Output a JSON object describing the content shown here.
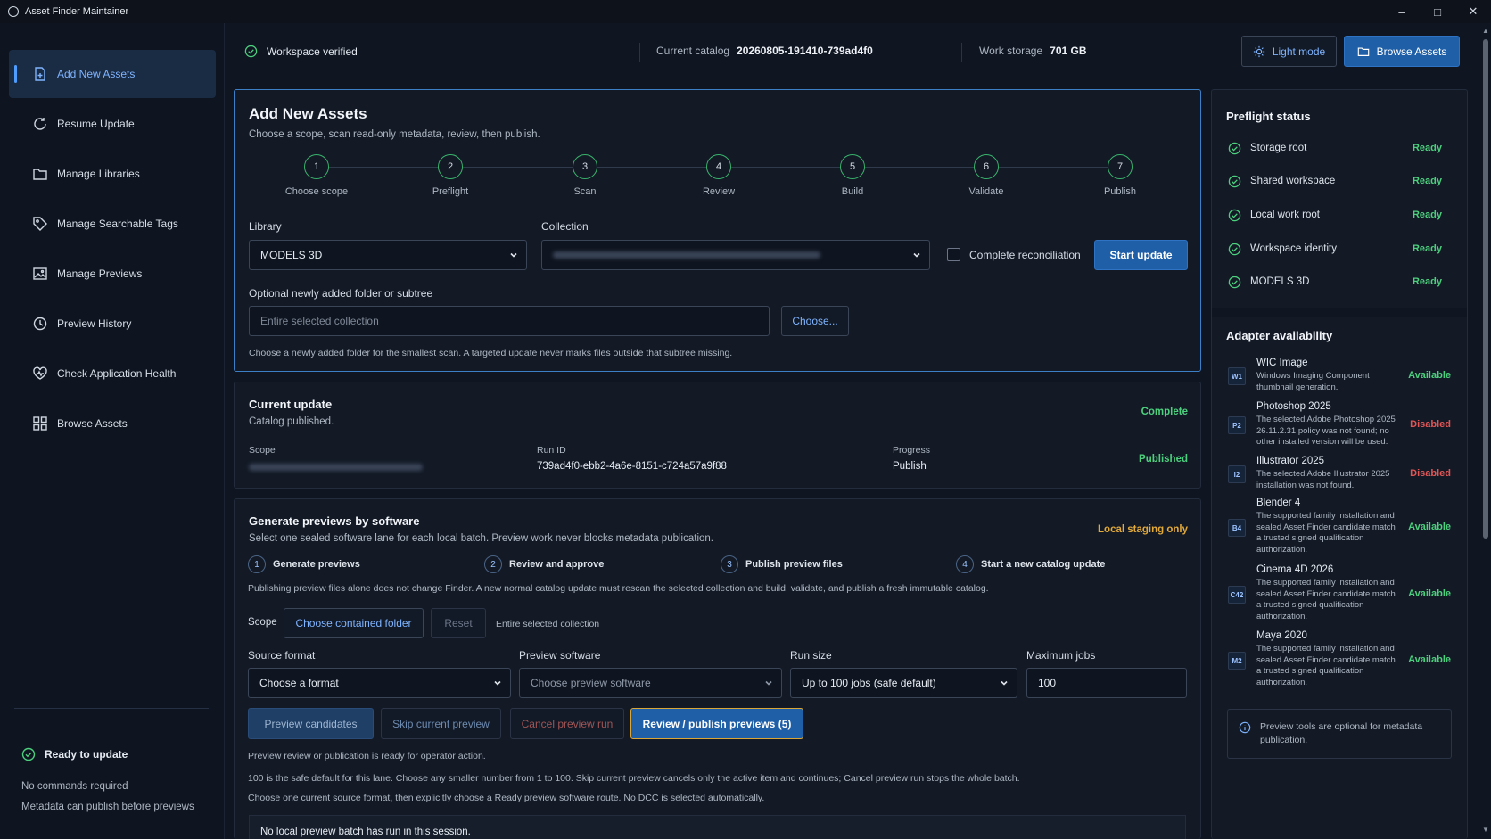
{
  "window": {
    "title": "Asset Finder Maintainer"
  },
  "sidebar": {
    "items": [
      {
        "label": "Add New Assets"
      },
      {
        "label": "Resume Update"
      },
      {
        "label": "Manage Libraries"
      },
      {
        "label": "Manage Searchable Tags"
      },
      {
        "label": "Manage Previews"
      },
      {
        "label": "Preview History"
      },
      {
        "label": "Check Application Health"
      },
      {
        "label": "Browse Assets"
      }
    ],
    "ready_label": "Ready to update",
    "notes": [
      "No commands required",
      "Metadata can publish before previews"
    ]
  },
  "topbar": {
    "workspace_status": "Workspace verified",
    "catalog_label": "Current catalog",
    "catalog_value": "20260805-191410-739ad4f0",
    "storage_label": "Work storage",
    "storage_value": "701 GB",
    "light_mode_label": "Light mode",
    "browse_label": "Browse Assets"
  },
  "add_assets": {
    "title": "Add New Assets",
    "subtitle": "Choose a scope, scan read-only metadata, review, then publish.",
    "steps": [
      {
        "num": "1",
        "label": "Choose scope"
      },
      {
        "num": "2",
        "label": "Preflight"
      },
      {
        "num": "3",
        "label": "Scan"
      },
      {
        "num": "4",
        "label": "Review"
      },
      {
        "num": "5",
        "label": "Build"
      },
      {
        "num": "6",
        "label": "Validate"
      },
      {
        "num": "7",
        "label": "Publish"
      }
    ],
    "library_label": "Library",
    "library_value": "MODELS 3D",
    "collection_label": "Collection",
    "reconcile_label": "Complete reconciliation",
    "start_label": "Start update",
    "folder_label": "Optional newly added folder or subtree",
    "folder_placeholder": "Entire selected collection",
    "choose_label": "Choose...",
    "folder_help": "Choose a newly added folder for the smallest scan. A targeted update never marks files outside that subtree missing."
  },
  "current_update": {
    "title": "Current update",
    "subtitle": "Catalog published.",
    "status": "Complete",
    "scope_label": "Scope",
    "runid_label": "Run ID",
    "runid_value": "739ad4f0-ebb2-4a6e-8151-c724a57a9f88",
    "progress_label": "Progress",
    "progress_value": "Publish",
    "result": "Published"
  },
  "generate": {
    "title": "Generate previews by software",
    "subtitle": "Select one sealed software lane for each local batch. Preview work never blocks metadata publication.",
    "badge": "Local staging only",
    "steps": [
      {
        "num": "1",
        "label": "Generate previews"
      },
      {
        "num": "2",
        "label": "Review and approve"
      },
      {
        "num": "3",
        "label": "Publish preview files"
      },
      {
        "num": "4",
        "label": "Start a new catalog update"
      }
    ],
    "note": "Publishing preview files alone does not change Finder. A new normal catalog update must rescan the selected collection and build, validate, and publish a fresh immutable catalog.",
    "scope_label": "Scope",
    "choose_folder_label": "Choose contained folder",
    "reset_label": "Reset",
    "scope_value": "Entire selected collection",
    "source_format_label": "Source format",
    "source_format_value": "Choose a format",
    "preview_software_label": "Preview software",
    "preview_software_value": "Choose preview software",
    "run_size_label": "Run size",
    "run_size_value": "Up to 100 jobs (safe default)",
    "max_jobs_label": "Maximum jobs",
    "max_jobs_value": "100",
    "btn_candidates": "Preview candidates",
    "btn_skip": "Skip current preview",
    "btn_cancel": "Cancel preview run",
    "btn_review": "Review / publish previews (5)",
    "info1": "Preview review or publication is ready for operator action.",
    "info2": "100 is the safe default for this lane. Choose any smaller number from 1 to 100. Skip current preview cancels only the active item and continues; Cancel preview run stops the whole batch.",
    "info3": "Choose one current source format, then explicitly choose a Ready preview software route. No DCC is selected automatically.",
    "batch_status": "No local preview batch has run in this session."
  },
  "preflight": {
    "title": "Preflight status",
    "rows": [
      {
        "name": "Storage root",
        "status": "Ready"
      },
      {
        "name": "Shared workspace",
        "status": "Ready"
      },
      {
        "name": "Local work root",
        "status": "Ready"
      },
      {
        "name": "Workspace identity",
        "status": "Ready"
      },
      {
        "name": "MODELS 3D",
        "status": "Ready"
      }
    ]
  },
  "adapters": {
    "title": "Adapter availability",
    "rows": [
      {
        "badge": "W1",
        "name": "WIC Image",
        "desc": "Windows Imaging Component thumbnail generation.",
        "status": "Available"
      },
      {
        "badge": "P2",
        "name": "Photoshop 2025",
        "desc": "The selected Adobe Photoshop 2025 26.11.2.31 policy was not found; no other installed version will be used.",
        "status": "Disabled"
      },
      {
        "badge": "I2",
        "name": "Illustrator 2025",
        "desc": "The selected Adobe Illustrator 2025 installation was not found.",
        "status": "Disabled"
      },
      {
        "badge": "B4",
        "name": "Blender 4",
        "desc": "The supported family installation and sealed Asset Finder candidate match a trusted signed qualification authorization.",
        "status": "Available"
      },
      {
        "badge": "C42",
        "name": "Cinema 4D 2026",
        "desc": "The supported family installation and sealed Asset Finder candidate match a trusted signed qualification authorization.",
        "status": "Available"
      },
      {
        "badge": "M2",
        "name": "Maya 2020",
        "desc": "The supported family installation and sealed Asset Finder candidate match a trusted signed qualification authorization.",
        "status": "Available"
      }
    ],
    "note": "Preview tools are optional for metadata publication."
  },
  "colors": {
    "accent": "#1f5fa8",
    "ok": "#4cd07d",
    "warn": "#e2a93b",
    "bad": "#e25555"
  }
}
